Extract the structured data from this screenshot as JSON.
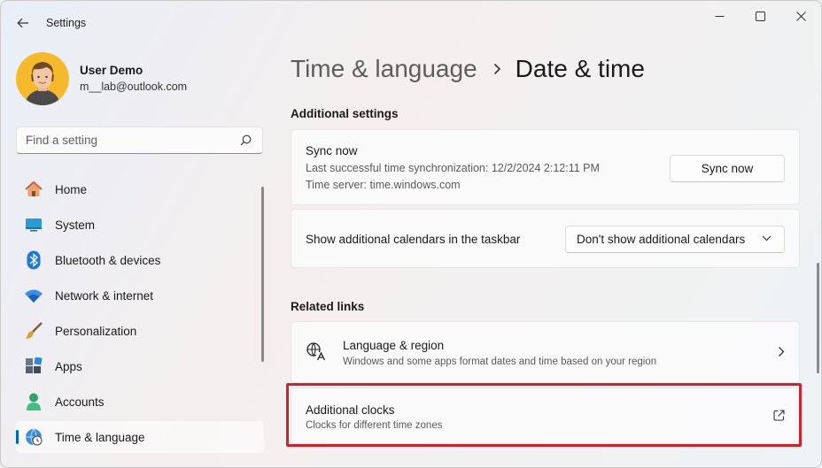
{
  "window": {
    "title": "Settings"
  },
  "profile": {
    "name": "User Demo",
    "email": "m__lab@outlook.com"
  },
  "search": {
    "placeholder": "Find a setting"
  },
  "sidebar": {
    "items": [
      {
        "label": "Home",
        "icon": "home-icon"
      },
      {
        "label": "System",
        "icon": "system-icon"
      },
      {
        "label": "Bluetooth & devices",
        "icon": "bluetooth-icon"
      },
      {
        "label": "Network & internet",
        "icon": "wifi-icon"
      },
      {
        "label": "Personalization",
        "icon": "brush-icon"
      },
      {
        "label": "Apps",
        "icon": "apps-icon"
      },
      {
        "label": "Accounts",
        "icon": "accounts-icon"
      },
      {
        "label": "Time & language",
        "icon": "globe-clock-icon",
        "active": true
      }
    ]
  },
  "breadcrumb": {
    "parent": "Time & language",
    "current": "Date & time"
  },
  "additional_settings": {
    "title": "Additional settings",
    "sync": {
      "title": "Sync now",
      "last_sync": "Last successful time synchronization: 12/2/2024 2:12:11 PM",
      "server": "Time server: time.windows.com",
      "button": "Sync now"
    },
    "calendars": {
      "label": "Show additional calendars in the taskbar",
      "selected": "Don't show additional calendars"
    }
  },
  "related_links": {
    "title": "Related links",
    "language_region": {
      "title": "Language & region",
      "subtitle": "Windows and some apps format dates and time based on your region"
    },
    "additional_clocks": {
      "title": "Additional clocks",
      "subtitle": "Clocks for different time zones"
    }
  },
  "colors": {
    "accent": "#0067c0",
    "highlight": "#d0212f"
  }
}
